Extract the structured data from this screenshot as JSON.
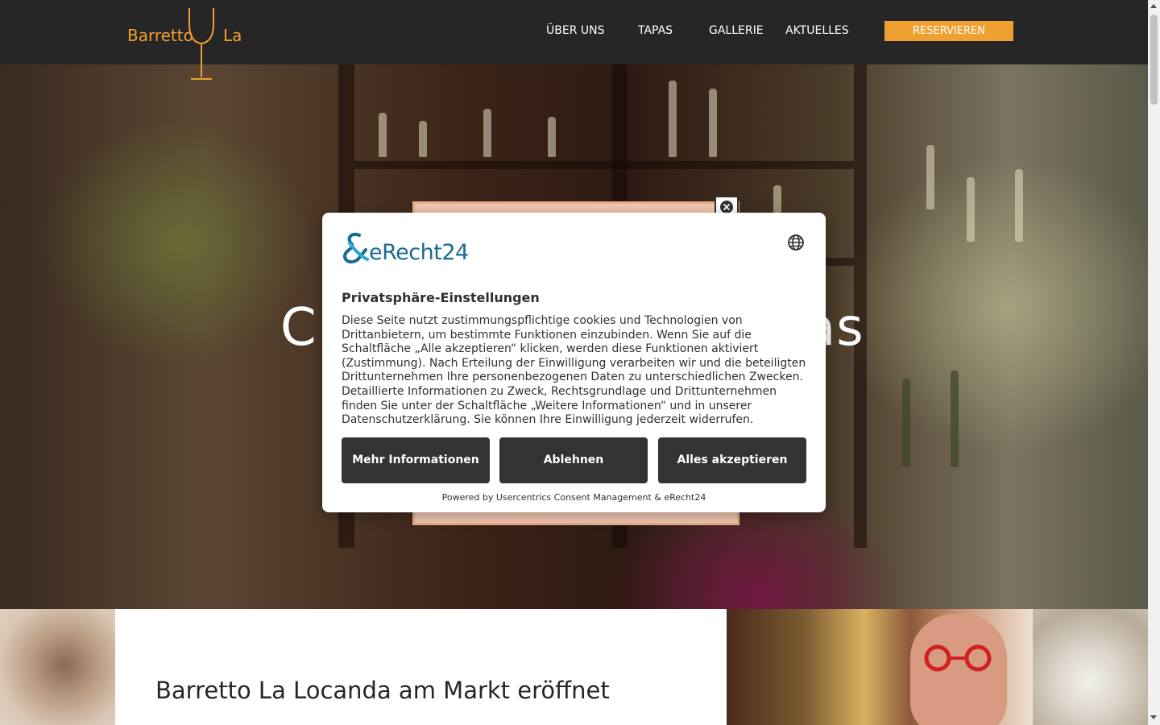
{
  "header": {
    "logo": {
      "word_left": "Barretto",
      "word_right": "La"
    },
    "nav": [
      "ÜBER UNS",
      "TAPAS",
      "GALLERIE",
      "AKTUELLES"
    ],
    "reserve_label": "RESERVIEREN",
    "brand_color": "#f0a030",
    "background": "#262626"
  },
  "hero": {
    "title_left": "C",
    "title_right": "as"
  },
  "consent": {
    "brand": "eRecht24",
    "title": "Privatsphäre-Einstellungen",
    "body": "Diese Seite nutzt zustimmungspflichtige cookies und Technologien von Drittanbietern, um bestimmte Funktionen einzubinden. Wenn Sie auf die Schaltfläche „Alle akzeptieren“ klicken, werden diese Funktionen aktiviert (Zustimmung). Nach Erteilung der Einwilligung verarbeiten wir und die beteiligten Drittunternehmen Ihre personenbezogenen Daten zu unterschiedlichen Zwecken. Detaillierte Informationen zu Zweck, Rechtsgrundlage und Drittunternehmen finden Sie unter der Schaltfläche „Weitere Informationen“ und in unserer Datenschutzerklärung. Sie können Ihre Einwilligung jederzeit widerrufen.",
    "buttons": {
      "more": "Mehr Informationen",
      "deny": "Ablehnen",
      "accept": "Alles akzeptieren"
    },
    "powered": "Powered by Usercentrics Consent Management & eRecht24",
    "button_color": "#333333",
    "icons": {
      "language": "globe-icon",
      "close": "close-circle-icon"
    }
  },
  "section": {
    "title": "Barretto La Locanda am Markt eröffnet"
  }
}
